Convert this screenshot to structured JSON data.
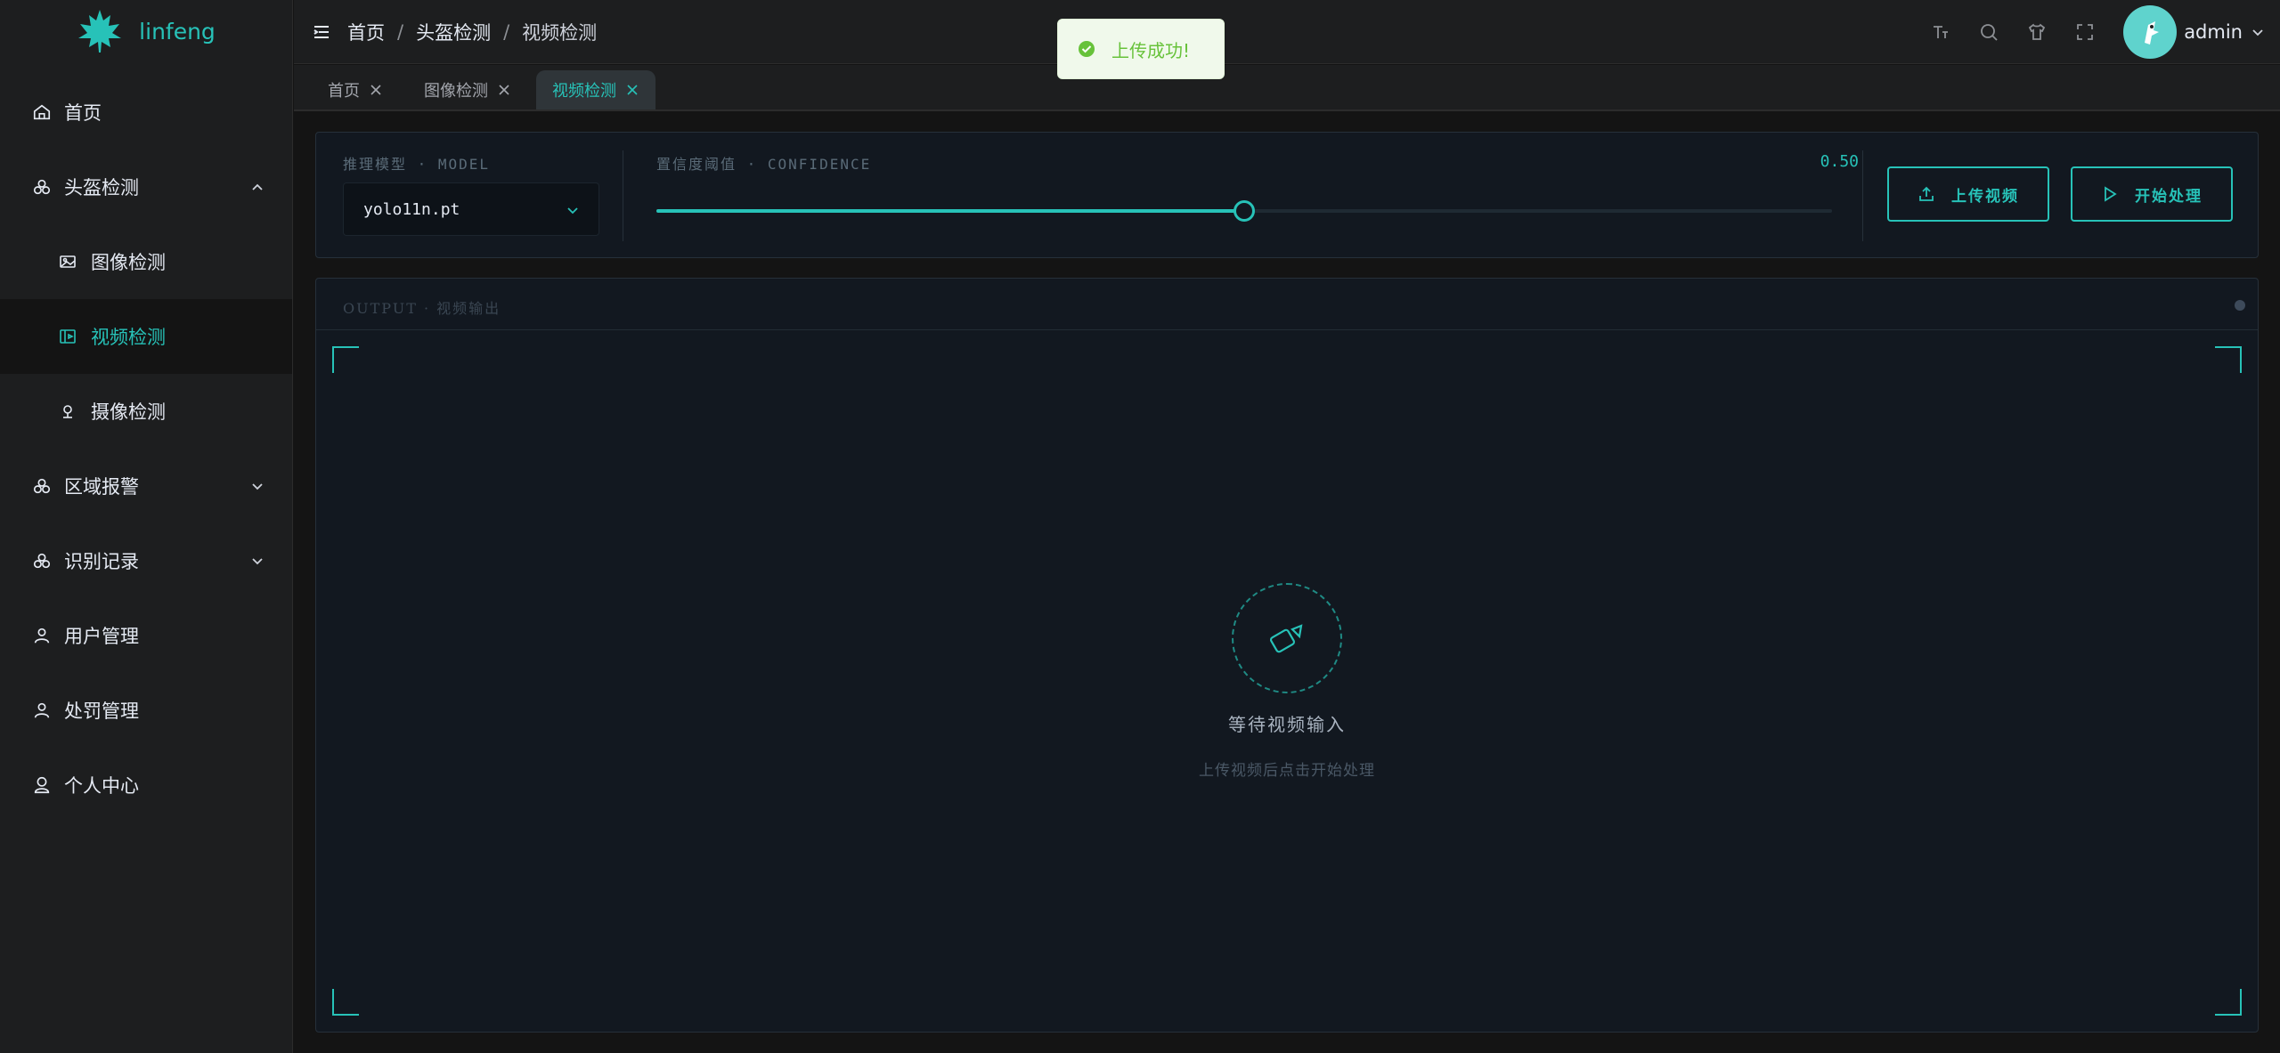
{
  "app": {
    "name": "linfeng"
  },
  "sidebar": {
    "items": [
      {
        "label": "首页",
        "icon": "home-icon"
      },
      {
        "label": "头盔检测",
        "icon": "helmet-icon",
        "expanded": true
      },
      {
        "label": "图像检测",
        "icon": "image-icon"
      },
      {
        "label": "视频检测",
        "icon": "video-icon",
        "active": true
      },
      {
        "label": "摄像检测",
        "icon": "camera-icon"
      },
      {
        "label": "区域报警",
        "icon": "region-icon"
      },
      {
        "label": "识别记录",
        "icon": "record-icon"
      },
      {
        "label": "用户管理",
        "icon": "user-icon"
      },
      {
        "label": "处罚管理",
        "icon": "penalty-icon"
      },
      {
        "label": "个人中心",
        "icon": "profile-icon"
      }
    ]
  },
  "header": {
    "breadcrumb": [
      "首页",
      "头盔检测",
      "视频检测"
    ],
    "user": "admin"
  },
  "tabs": [
    {
      "label": "首页"
    },
    {
      "label": "图像检测"
    },
    {
      "label": "视频检测",
      "active": true
    }
  ],
  "toast": {
    "message": "上传成功!"
  },
  "controls": {
    "model_label": "推理模型 · MODEL",
    "model_value": "yolo11n.pt",
    "confidence_label": "置信度阈值 · CONFIDENCE",
    "confidence_value": "0.50",
    "confidence": 0.5,
    "upload_button": "上传视频",
    "start_button": "开始处理"
  },
  "output": {
    "title": "OUTPUT · 视频输出",
    "placeholder_title": "等待视频输入",
    "placeholder_sub": "上传视频后点击开始处理"
  },
  "colors": {
    "accent": "#27c2b8",
    "success": "#67c23a"
  }
}
